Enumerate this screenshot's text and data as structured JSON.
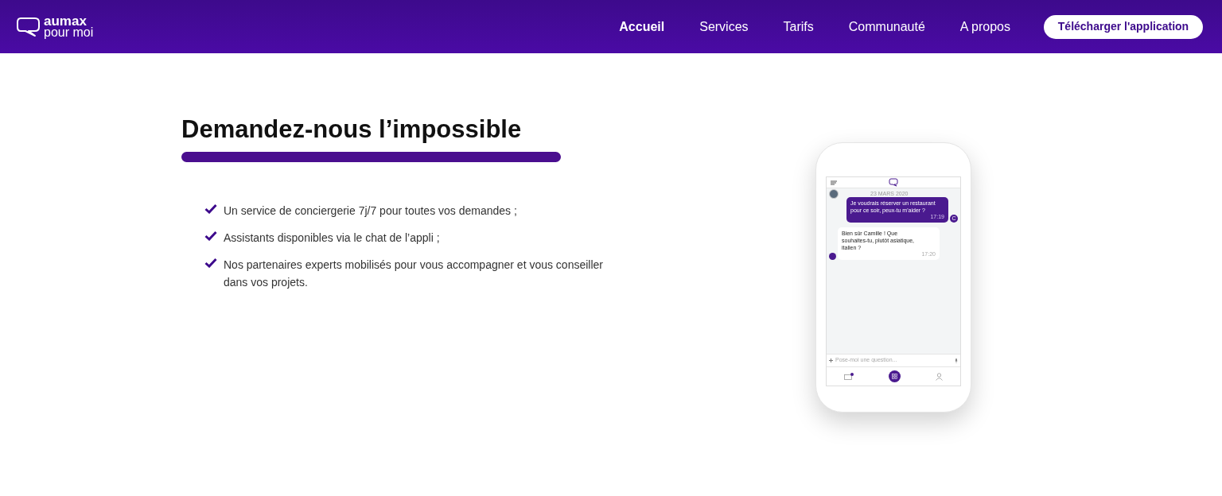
{
  "header": {
    "logo": {
      "line1": "aumax",
      "line2": "pour moi"
    },
    "nav": [
      {
        "label": "Accueil",
        "selected": true
      },
      {
        "label": "Services",
        "selected": false
      },
      {
        "label": "Tarifs",
        "selected": false
      },
      {
        "label": "Communauté",
        "selected": false
      },
      {
        "label": "A propos",
        "selected": false
      }
    ],
    "cta": "Télécharger l'application"
  },
  "hero": {
    "title": "Demandez-nous l’impossible",
    "features": [
      "Un service de conciergerie 7j/7 pour toutes vos demandes ;",
      "Assistants disponibles via le chat de l’appli ;",
      "Nos partenaires experts mobilisés pour vous accompagner et vous conseiller dans vos projets."
    ]
  },
  "phone": {
    "date": "23 MARS 2020",
    "messages": [
      {
        "kind": "user",
        "text": "Je voudrais réserver un restaurant pour ce soir, peux-tu m'aider ?",
        "time": "17:19",
        "avatar": "C"
      },
      {
        "kind": "assistant",
        "text": "Bien sûr Camille ! Que souhaites-tu, plutôt asiatique, italien ?",
        "time": "17:20"
      }
    ],
    "input": {
      "placeholder": "Pose-moi une question..."
    }
  }
}
